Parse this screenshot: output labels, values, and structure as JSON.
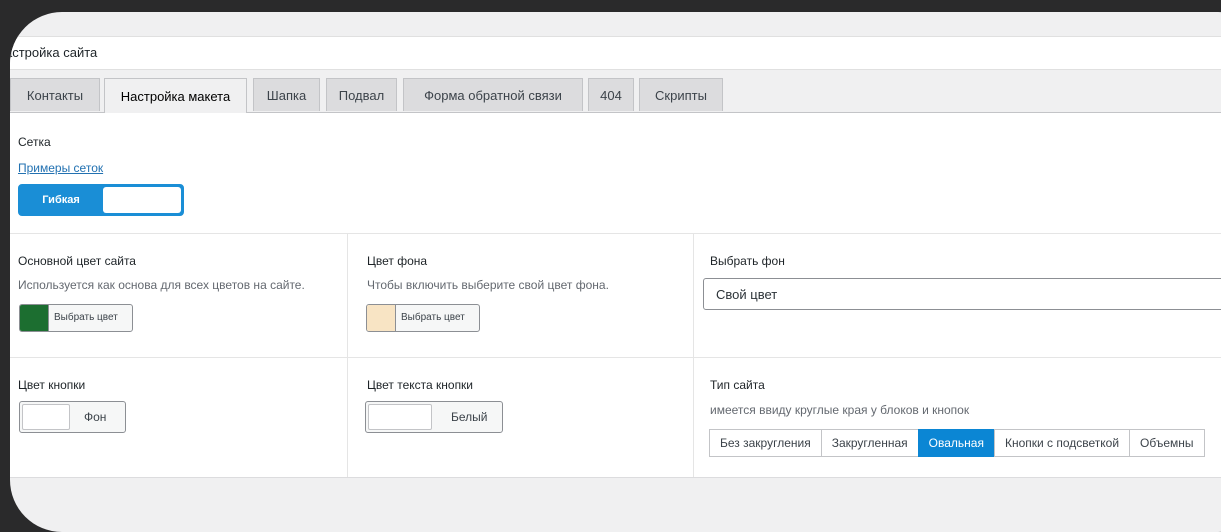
{
  "page": {
    "title": "астройка сайта"
  },
  "tabs": [
    {
      "label": "Контакты"
    },
    {
      "label": "Настройка макета",
      "active": true
    },
    {
      "label": "Шапка"
    },
    {
      "label": "Подвал"
    },
    {
      "label": "Форма обратной связи"
    },
    {
      "label": "404"
    },
    {
      "label": "Скрипты"
    }
  ],
  "grid": {
    "label": "Сетка",
    "link": "Примеры сеток",
    "toggle_on": "Гибкая"
  },
  "main_color": {
    "label": "Основной цвет сайта",
    "description": "Используется как основа для всех цветов на сайте.",
    "button": "Выбрать цвет",
    "color": "#1c6e30"
  },
  "bg_color": {
    "label": "Цвет фона",
    "description": "Чтобы включить выберите свой цвет фона.",
    "button": "Выбрать цвет",
    "color": "#f8e4c4"
  },
  "bg_select": {
    "label": "Выбрать фон",
    "value": "Свой цвет"
  },
  "button_color": {
    "label": "Цвет кнопки",
    "value": "Фон"
  },
  "button_text_color": {
    "label": "Цвет текста кнопки",
    "value": "Белый"
  },
  "site_type": {
    "label": "Тип сайта",
    "description": "имеется ввиду круглые края у блоков и кнопок",
    "options": [
      {
        "label": "Без закругления"
      },
      {
        "label": "Закругленная"
      },
      {
        "label": "Овальная",
        "active": true
      },
      {
        "label": "Кнопки с подсветкой"
      },
      {
        "label": "Объемны"
      }
    ]
  },
  "colors": {
    "accent": "#0b86d4",
    "link": "#2271b1"
  }
}
